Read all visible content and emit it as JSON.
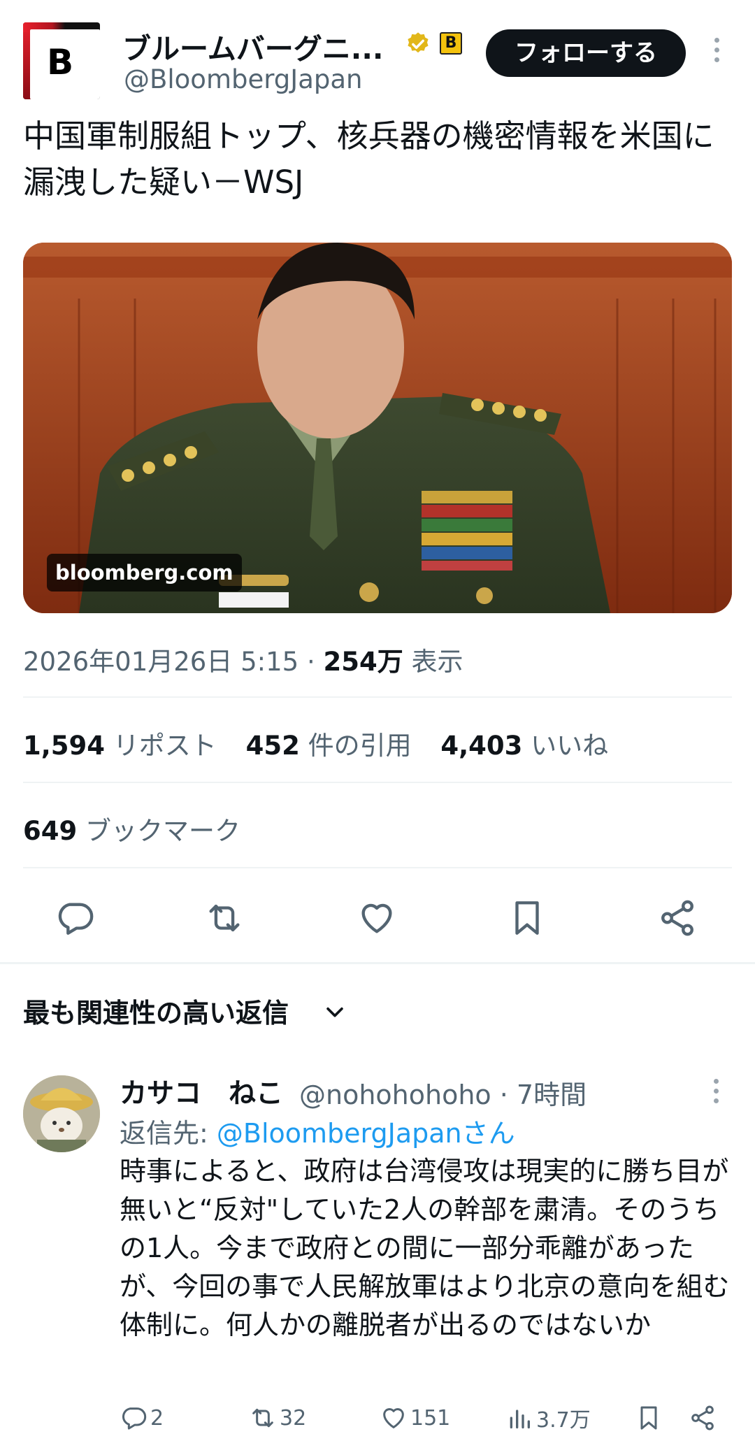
{
  "account": {
    "name": "ブルームバーグニ...",
    "handle": "@BloombergJapan",
    "logo_letter": "B",
    "affiliate_letter": "B",
    "follow_label": "フォローする"
  },
  "tweet": {
    "text": "中国軍制服組トップ、核兵器の機密情報を米国に漏洩した疑い－WSJ",
    "media_badge": "bloomberg.com",
    "datetime": "2026年01月26日 5:15",
    "separator": "·",
    "views_count": "254万",
    "views_label": "表示"
  },
  "stats": {
    "reposts_count": "1,594",
    "reposts_label": "リポスト",
    "quotes_count": "452",
    "quotes_label": "件の引用",
    "likes_count": "4,403",
    "likes_label": "いいね",
    "bookmarks_count": "649",
    "bookmarks_label": "ブックマーク"
  },
  "actions": [
    "reply-icon",
    "repost-icon",
    "like-icon",
    "bookmark-icon",
    "share-icon"
  ],
  "replies": {
    "header": "最も関連性の高い返信",
    "items": [
      {
        "name": "カサコ　ねこ",
        "handle": "@nohohohoho",
        "time": "· 7時間",
        "reply_to_prefix": "返信先: ",
        "reply_to_link": "@BloombergJapanさん",
        "text": "時事によると、政府は台湾侵攻は現実的に勝ち目が無いと“反対\"していた2人の幹部を粛清。そのうちの1人。今まで政府との間に一部分乖離があったが、今回の事で人民解放軍はより北京の意向を組む体制に。何人かの離脱者が出るのではないか",
        "replies_count": "2",
        "reposts_count": "32",
        "likes_count": "151",
        "views_count": "3.7万"
      }
    ]
  },
  "colors": {
    "text_primary": "#0f1419",
    "text_secondary": "#536471",
    "link": "#1d9bf0",
    "divider": "#eff3f4",
    "follow_bg": "#0f1419",
    "verified_gold": "#e2b719"
  }
}
